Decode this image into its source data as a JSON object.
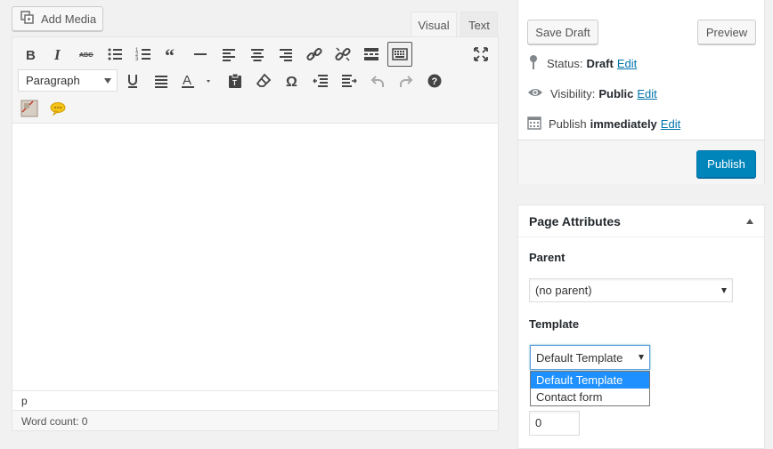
{
  "media": {
    "add_media_label": "Add Media"
  },
  "editor_tabs": {
    "visual": "Visual",
    "text": "Text"
  },
  "toolbar": {
    "format_select_value": "Paragraph",
    "row1": [
      "bold-icon",
      "italic-icon",
      "strikethrough-icon",
      "bullet-list-icon",
      "numbered-list-icon",
      "blockquote-icon",
      "horizontal-line-icon",
      "align-left-icon",
      "align-center-icon",
      "align-right-icon",
      "insert-link-icon",
      "remove-link-icon",
      "read-more-icon",
      "toolbar-toggle-icon"
    ],
    "row2": [
      "underline-icon",
      "justify-icon",
      "text-color-icon",
      "paste-as-text-icon",
      "clear-formatting-icon",
      "special-character-icon",
      "outdent-icon",
      "indent-icon",
      "undo-icon",
      "redo-icon",
      "help-icon"
    ]
  },
  "editor": {
    "path": "p",
    "word_count": "Word count: 0"
  },
  "publish": {
    "save_draft": "Save Draft",
    "preview": "Preview",
    "status_label": "Status:",
    "status_value": "Draft",
    "visibility_label": "Visibility:",
    "visibility_value": "Public",
    "publish_label": "Publish",
    "publish_value": "immediately",
    "edit": "Edit",
    "publish_button": "Publish"
  },
  "page_attributes": {
    "title": "Page Attributes",
    "parent_label": "Parent",
    "parent_value": "(no parent)",
    "template_label": "Template",
    "template_value": "Default Template",
    "template_options": [
      "Default Template",
      "Contact form"
    ],
    "order_value": "0"
  },
  "colors": {
    "primary": "#0085ba",
    "link": "#0073aa",
    "selected_option": "#1e90ff"
  }
}
